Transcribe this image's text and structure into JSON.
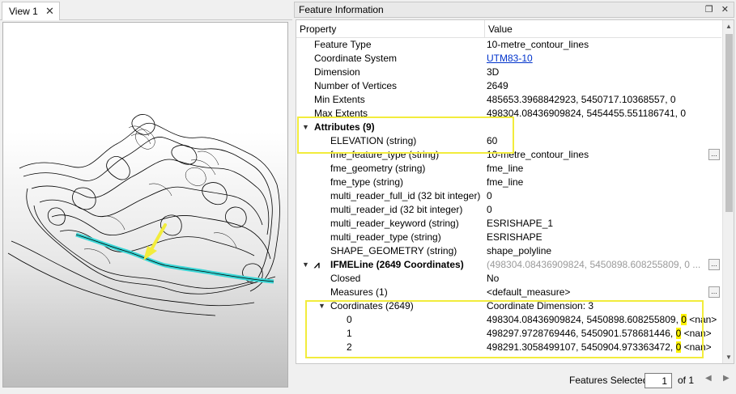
{
  "tab": {
    "label": "View 1"
  },
  "panel": {
    "title": "Feature Information"
  },
  "columns": {
    "property": "Property",
    "value": "Value"
  },
  "rows": {
    "feature_type": {
      "p": "Feature Type",
      "v": "10-metre_contour_lines"
    },
    "coord_system": {
      "p": "Coordinate System",
      "v": "UTM83-10"
    },
    "dimension": {
      "p": "Dimension",
      "v": "3D"
    },
    "num_vertices": {
      "p": "Number of Vertices",
      "v": "2649"
    },
    "min_extents": {
      "p": "Min Extents",
      "v": "485653.3968842923, 5450717.10368557, 0"
    },
    "max_extents": {
      "p": "Max Extents",
      "v": "498304.08436909824, 5454455.551186741, 0"
    },
    "attributes": {
      "p": "Attributes (9)"
    },
    "elevation": {
      "p": "ELEVATION (string)",
      "v": "60"
    },
    "fme_feature_type": {
      "p": "fme_feature_type (string)",
      "v": "10-metre_contour_lines"
    },
    "fme_geometry": {
      "p": "fme_geometry (string)",
      "v": "fme_line"
    },
    "fme_type": {
      "p": "fme_type (string)",
      "v": "fme_line"
    },
    "mr_full_id": {
      "p": "multi_reader_full_id (32 bit integer)",
      "v": "0"
    },
    "mr_id": {
      "p": "multi_reader_id (32 bit integer)",
      "v": "0"
    },
    "mr_keyword": {
      "p": "multi_reader_keyword (string)",
      "v": "ESRISHAPE_1"
    },
    "mr_type": {
      "p": "multi_reader_type (string)",
      "v": "ESRISHAPE"
    },
    "shape_geometry": {
      "p": "SHAPE_GEOMETRY (string)",
      "v": "shape_polyline"
    },
    "ifmeline": {
      "p": "IFMELine (2649 Coordinates)",
      "v": "(498304.08436909824, 5450898.608255809, 0 ..."
    },
    "closed": {
      "p": "Closed",
      "v": "No"
    },
    "measures": {
      "p": "Measures (1)",
      "v": "<default_measure>"
    },
    "coordinates": {
      "p": "Coordinates (2649)",
      "v": "Coordinate Dimension: 3"
    },
    "coord0": {
      "p": "0",
      "v1": "498304.08436909824, 5450898.608255809,",
      "z": "0",
      "n": "<nan>"
    },
    "coord1": {
      "p": "1",
      "v1": "498297.9728769446, 5450901.578681446,",
      "z": "0",
      "n": "<nan>"
    },
    "coord2": {
      "p": "2",
      "v1": "498291.3058499107, 5450904.973363472,",
      "z": "0",
      "n": "<nan>"
    }
  },
  "footer": {
    "features_selected_label": "Features Selected:",
    "page": "1",
    "of_label": "of 1"
  },
  "colors": {
    "highlight": "#f2ec3c",
    "selected_line": "#3ad6d6",
    "link": "#0033cc"
  }
}
